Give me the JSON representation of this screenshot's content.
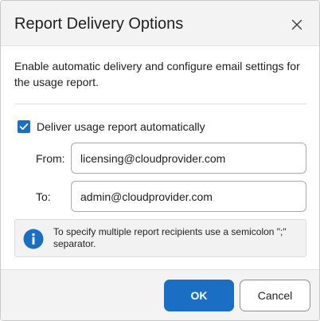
{
  "dialog": {
    "title": "Report Delivery Options",
    "description": "Enable automatic delivery and configure email settings for the usage report."
  },
  "delivery": {
    "checkbox_label": "Deliver usage report automatically",
    "checked": true
  },
  "fields": {
    "from_label": "From:",
    "from_value": "licensing@cloudprovider.com",
    "to_label": "To:",
    "to_value": "admin@cloudprovider.com"
  },
  "info": {
    "text": "To specify multiple report recipients use a semicolon \";\" separator."
  },
  "footer": {
    "ok_label": "OK",
    "cancel_label": "Cancel"
  },
  "colors": {
    "accent": "#1a6fc4",
    "header_bg": "#f3f3f3",
    "info_bg": "#f2f2f2"
  },
  "icons": {
    "close": "close-icon",
    "check": "checkmark-icon",
    "info": "info-icon"
  }
}
